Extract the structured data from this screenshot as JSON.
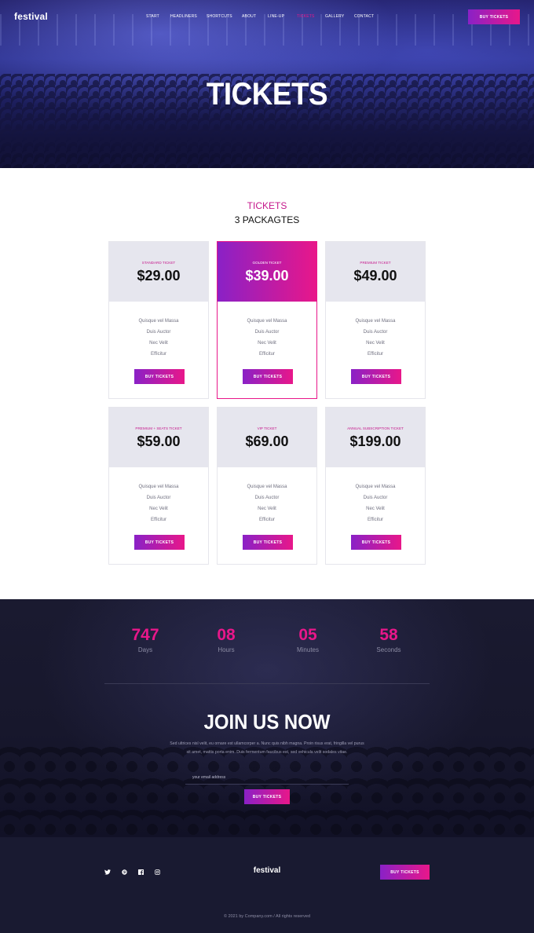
{
  "brand": {
    "logo": "festival",
    "accent": "#e8178a",
    "accent_start": "#8a21c6"
  },
  "nav": {
    "items": [
      "Start",
      "Headliners",
      "Shortcuts",
      "About",
      "Line-up",
      "Tickets",
      "Gallery",
      "Contact"
    ],
    "active": "Tickets",
    "cta": "Buy Tickets"
  },
  "hero": {
    "title": "TICKETS"
  },
  "tickets": {
    "eyebrow": "TICKETS",
    "heading": "3 PACKAGTES",
    "cards": [
      {
        "name": "Standard Ticket",
        "price": "$29.00",
        "featured": false,
        "features": [
          "Quisque vel Massa",
          "Duis Auctor",
          "Nec Velit",
          "Efficitur"
        ],
        "button": "Buy Tickets"
      },
      {
        "name": "Golden Ticket",
        "price": "$39.00",
        "featured": true,
        "features": [
          "Quisque vel Massa",
          "Duis Auctor",
          "Nec Velit",
          "Efficitur"
        ],
        "button": "Buy Tickets"
      },
      {
        "name": "Premium Ticket",
        "price": "$49.00",
        "featured": false,
        "features": [
          "Quisque vel Massa",
          "Duis Auctor",
          "Nec Velit",
          "Efficitur"
        ],
        "button": "Buy Tickets"
      },
      {
        "name": "Premium + Seats Ticket",
        "price": "$59.00",
        "featured": false,
        "features": [
          "Quisque vel Massa",
          "Duis Auctor",
          "Nec Velit",
          "Efficitur"
        ],
        "button": "Buy Tickets"
      },
      {
        "name": "VIP Ticket",
        "price": "$69.00",
        "featured": false,
        "features": [
          "Quisque vel Massa",
          "Duis Auctor",
          "Nec Velit",
          "Efficitur"
        ],
        "button": "Buy Tickets"
      },
      {
        "name": "Annual Subscription Ticket",
        "price": "$199.00",
        "featured": false,
        "features": [
          "Quisque vel Massa",
          "Duis Auctor",
          "Nec Velit",
          "Efficitur"
        ],
        "button": "Buy Tickets"
      }
    ]
  },
  "countdown": [
    {
      "value": "747",
      "label": "Days"
    },
    {
      "value": "08",
      "label": "Hours"
    },
    {
      "value": "05",
      "label": "Minutes"
    },
    {
      "value": "58",
      "label": "Seconds"
    }
  ],
  "join": {
    "title": "JOIN US NOW",
    "text": "Sed ultrices nisl velit, eu ornare est ullamcorper a. Nunc quis nibh magna. Proin risus erat, fringilla vel purus sit amet, mattis porta enim. Duis fermentum faucibus est, sed vehicula velit sodales vitae.",
    "email_placeholder": "your email address",
    "email_value": "",
    "button": "Buy Tickets"
  },
  "footer": {
    "social_icons": [
      "twitter-icon",
      "pinterest-icon",
      "facebook-icon",
      "instagram-icon"
    ],
    "logo": "festival",
    "button": "Buy Tickets",
    "copyright": "©  2021 by Company.com  /  All rights reserved"
  }
}
